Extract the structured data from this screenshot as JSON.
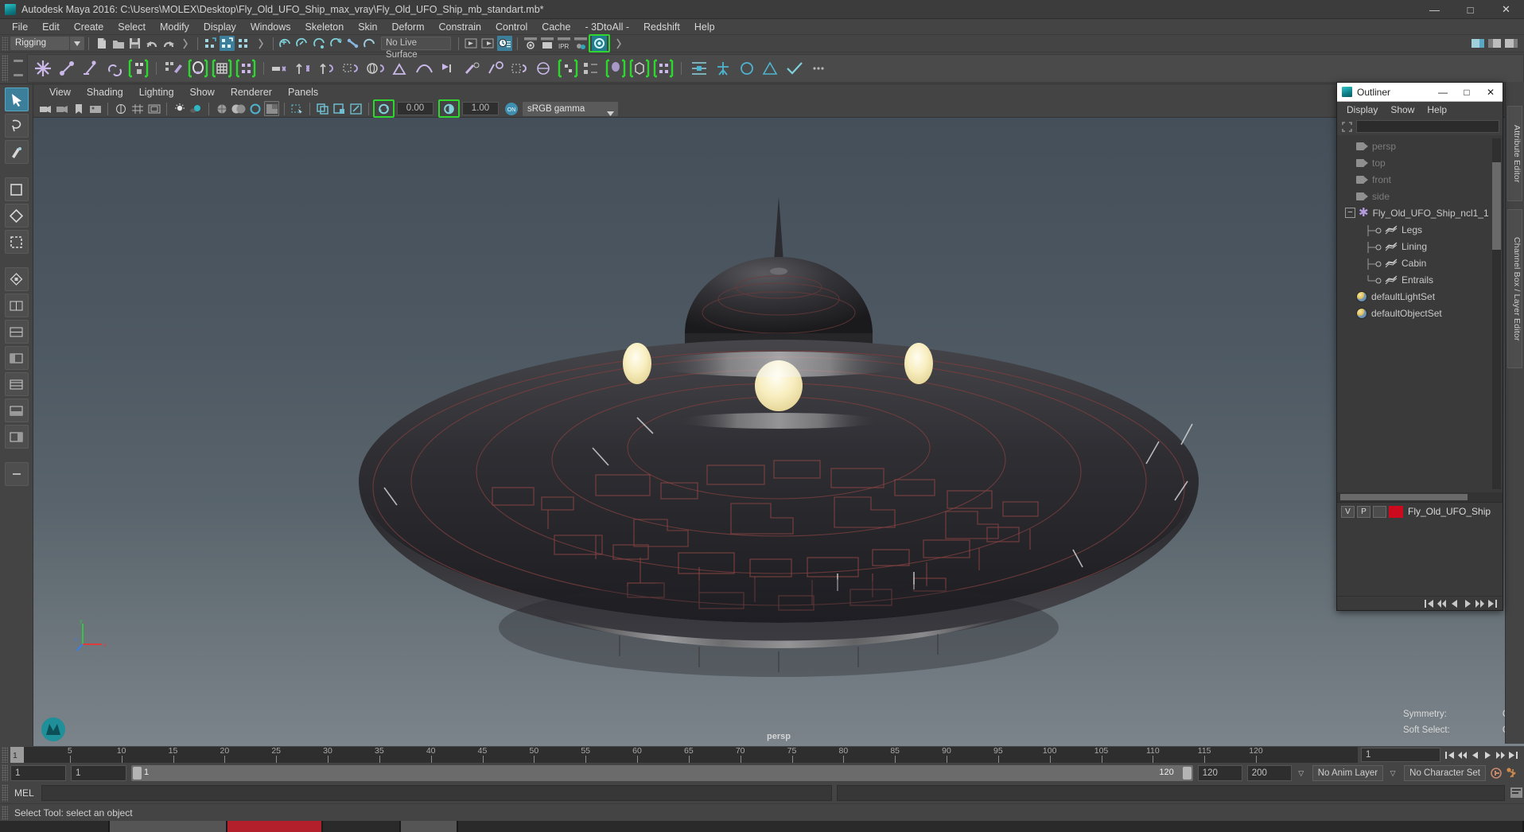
{
  "window": {
    "title": "Autodesk Maya 2016: C:\\Users\\MOLEX\\Desktop\\Fly_Old_UFO_Ship_max_vray\\Fly_Old_UFO_Ship_mb_standart.mb*",
    "minimize": "—",
    "maximize": "□",
    "close": "✕"
  },
  "menubar": {
    "items": [
      {
        "label": "File"
      },
      {
        "label": "Edit"
      },
      {
        "label": "Create"
      },
      {
        "label": "Select"
      },
      {
        "label": "Modify"
      },
      {
        "label": "Display"
      },
      {
        "label": "Windows"
      },
      {
        "label": "Skeleton"
      },
      {
        "label": "Skin"
      },
      {
        "label": "Deform"
      },
      {
        "label": "Constrain"
      },
      {
        "label": "Control"
      },
      {
        "label": "Cache"
      },
      {
        "label": "- 3DtoAll -"
      },
      {
        "label": "Redshift"
      },
      {
        "label": "Help"
      }
    ]
  },
  "statusline": {
    "menuset": "Rigging",
    "menuset_arrow": "▼",
    "live_surface": "No Live Surface"
  },
  "viewport_menu": {
    "items": [
      {
        "label": "View"
      },
      {
        "label": "Shading"
      },
      {
        "label": "Lighting"
      },
      {
        "label": "Show"
      },
      {
        "label": "Renderer"
      },
      {
        "label": "Panels"
      }
    ]
  },
  "viewport_toolbar": {
    "exposure_value": "0.00",
    "gamma_value": "1.00",
    "color_management": "sRGB gamma",
    "cm_toggle": "ON",
    "dropdown_arrow": "▼"
  },
  "viewport": {
    "camera_label": "persp",
    "hud": [
      {
        "label": "Symmetry:",
        "value": "Off"
      },
      {
        "label": "Soft Select:",
        "value": "Off"
      }
    ],
    "axis": {
      "x": "x",
      "y": "y",
      "z": "z"
    }
  },
  "outliner": {
    "title": "Outliner",
    "minimize": "—",
    "maximize": "□",
    "close": "✕",
    "menus": [
      {
        "label": "Display"
      },
      {
        "label": "Show"
      },
      {
        "label": "Help"
      }
    ],
    "search_value": "",
    "tree": [
      {
        "label": "persp",
        "type": "camera",
        "depth": 1,
        "dim": true
      },
      {
        "label": "top",
        "type": "camera",
        "depth": 1,
        "dim": true
      },
      {
        "label": "front",
        "type": "camera",
        "depth": 1,
        "dim": true
      },
      {
        "label": "side",
        "type": "camera",
        "depth": 1,
        "dim": true
      },
      {
        "label": "Fly_Old_UFO_Ship_ncl1_1",
        "type": "group",
        "depth": 0,
        "dim": false,
        "expander": "−"
      },
      {
        "label": "Legs",
        "type": "mesh",
        "depth": 2,
        "dim": false
      },
      {
        "label": "Lining",
        "type": "mesh",
        "depth": 2,
        "dim": false
      },
      {
        "label": "Cabin",
        "type": "mesh",
        "depth": 2,
        "dim": false
      },
      {
        "label": "Entrails",
        "type": "mesh",
        "depth": 2,
        "dim": false
      },
      {
        "label": "defaultLightSet",
        "type": "set",
        "depth": 1,
        "dim": false
      },
      {
        "label": "defaultObjectSet",
        "type": "set",
        "depth": 1,
        "dim": false
      }
    ],
    "layers": {
      "columns": [
        "V",
        "P"
      ],
      "rows": [
        {
          "visible": "V",
          "playback": "P",
          "color": "#cc0a1e",
          "name": "Fly_Old_UFO_Ship"
        }
      ]
    }
  },
  "right_dock": {
    "tabs": [
      {
        "label": "Attribute Editor"
      },
      {
        "label": "Channel Box / Layer Editor"
      }
    ]
  },
  "time_slider": {
    "current_frame": "1",
    "ticks": [
      5,
      10,
      15,
      20,
      25,
      30,
      35,
      40,
      45,
      50,
      55,
      60,
      65,
      70,
      75,
      80,
      85,
      90,
      95,
      100,
      105,
      110,
      115,
      120
    ],
    "end_field": "1",
    "playback_buttons": [
      "⏮",
      "⏪",
      "◀",
      "▶",
      "▶▶",
      "⏭"
    ]
  },
  "range_slider": {
    "start_field": "1",
    "anim_start": "1",
    "bar_start_label": "1",
    "bar_end_label": "120",
    "anim_end": "120",
    "end_field": "200",
    "anim_layer": "No Anim Layer",
    "character_set": "No Character Set",
    "dropdown_arrow": "▽"
  },
  "command_line": {
    "language": "MEL",
    "input_value": "",
    "output_value": ""
  },
  "help_line": {
    "text": "Select Tool: select an object"
  },
  "colors": {
    "accent_green": "#2fd62f",
    "accent_blue": "#3b7f9b",
    "layer_red": "#cc0a1e",
    "panel_bg": "#444444",
    "dark_bg": "#2e2e2e"
  }
}
